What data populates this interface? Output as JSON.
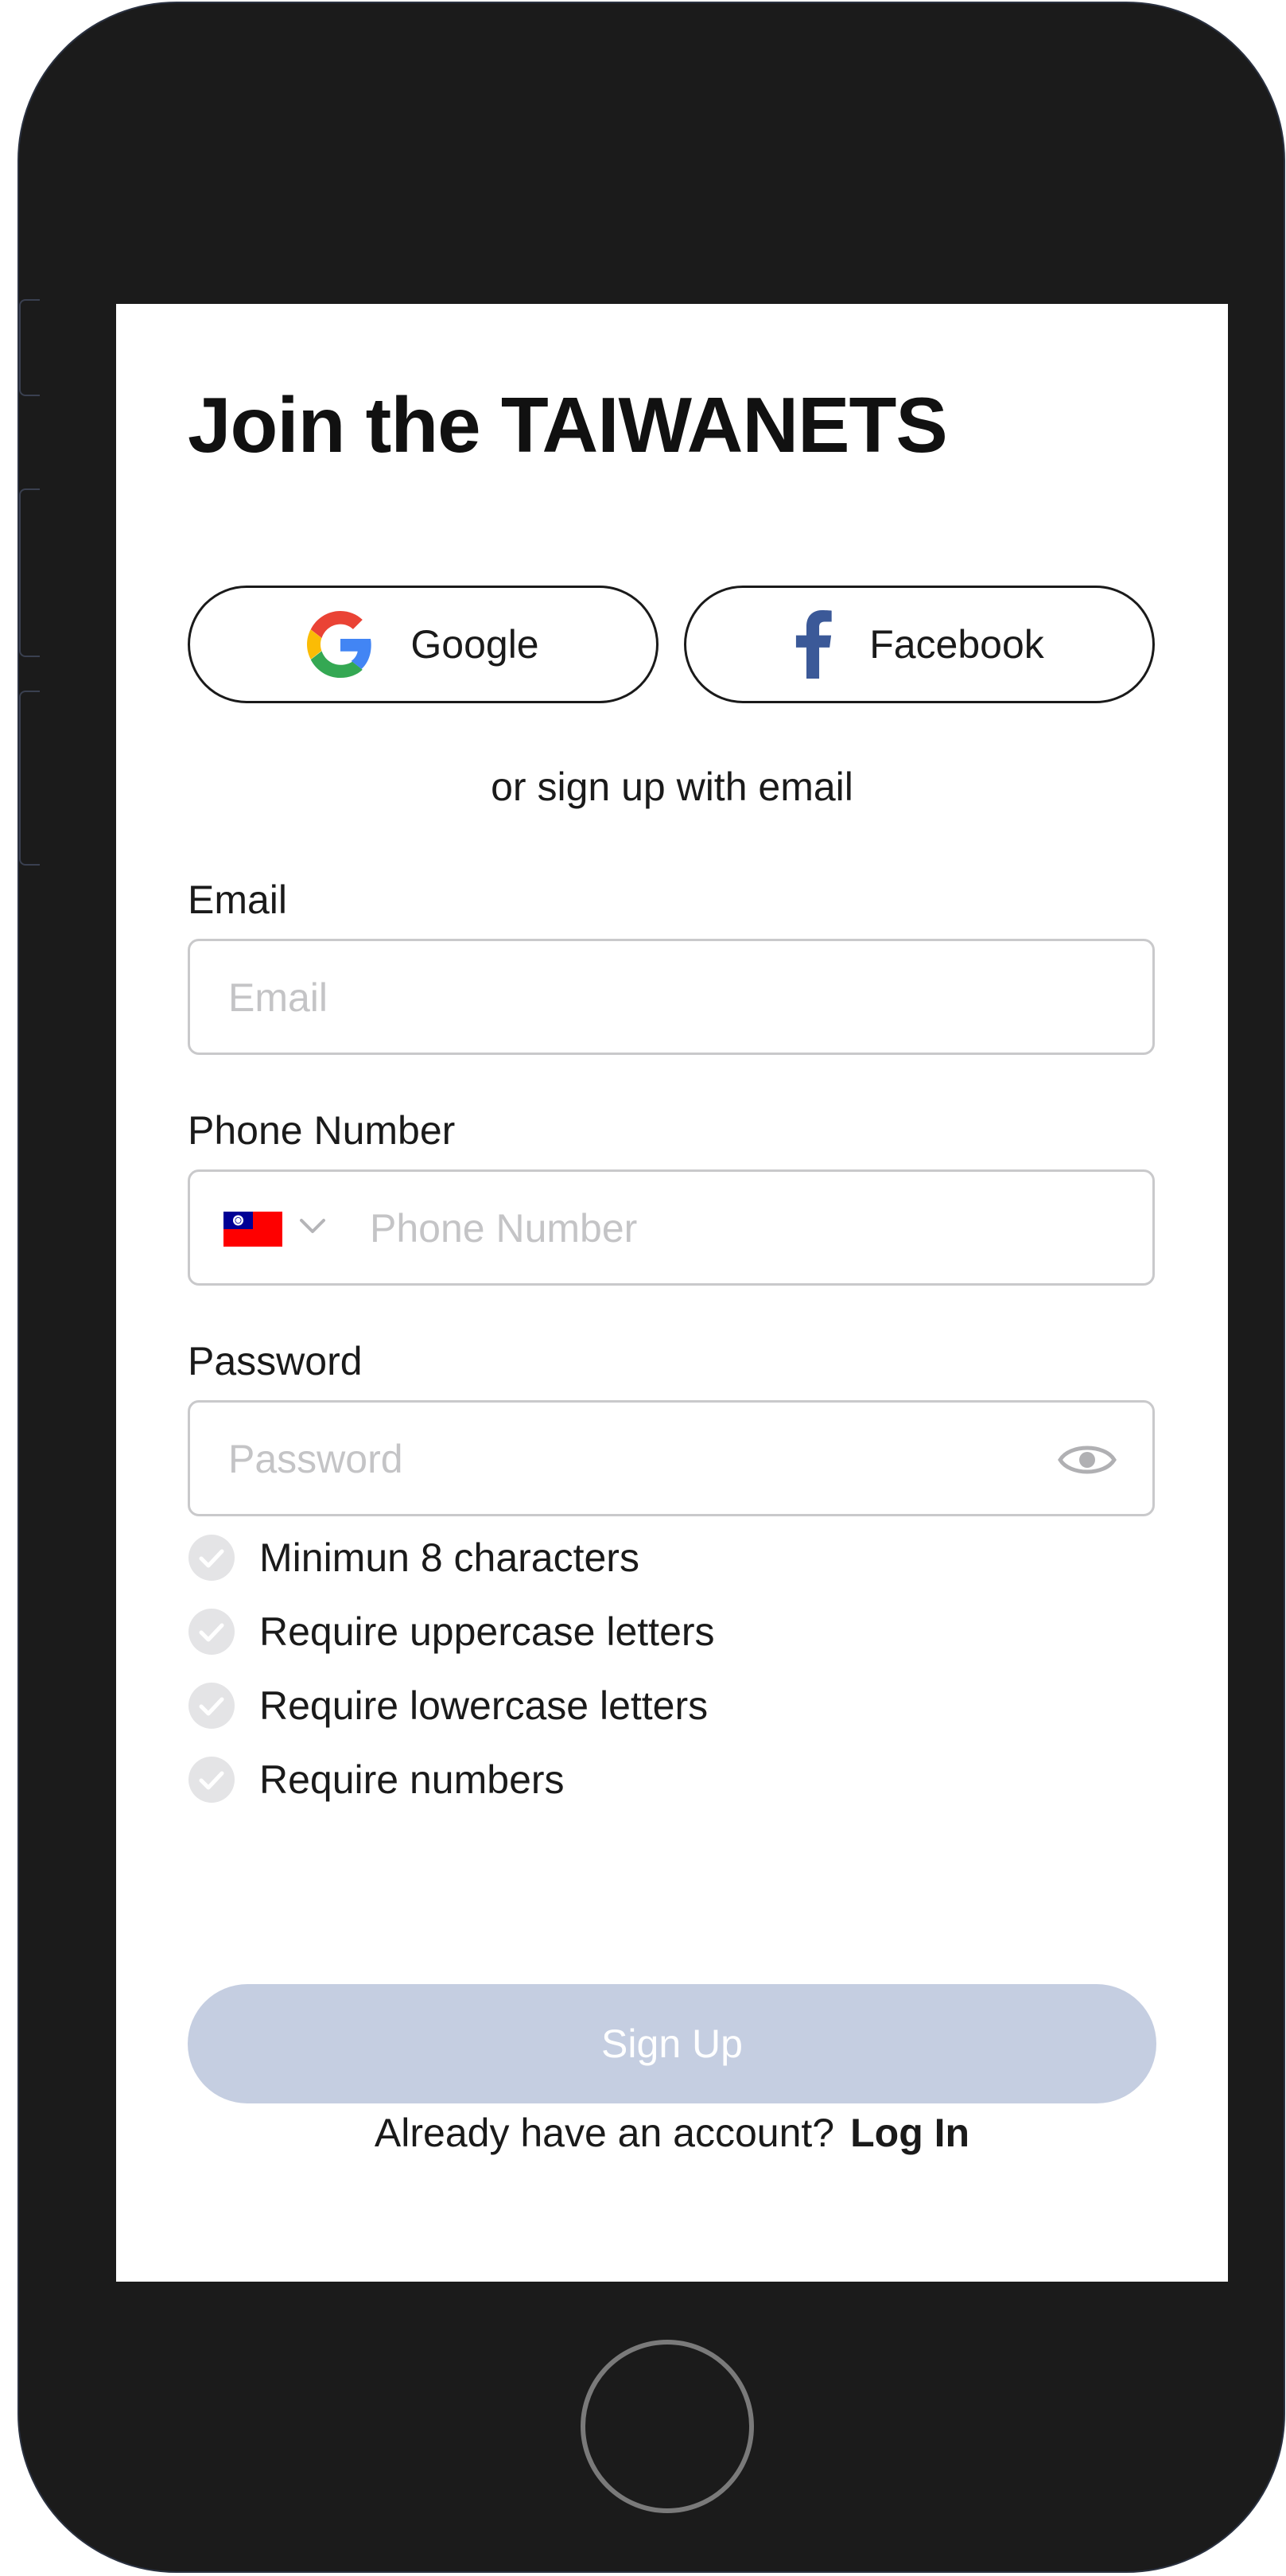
{
  "title": "Join the TAIWANETS",
  "social": {
    "google_label": "Google",
    "facebook_label": "Facebook"
  },
  "divider_text": "or sign up with email",
  "fields": {
    "email": {
      "label": "Email",
      "placeholder": "Email",
      "value": ""
    },
    "phone": {
      "label": "Phone Number",
      "placeholder": "Phone Number",
      "value": "",
      "country_flag": "taiwan-flag-icon"
    },
    "password": {
      "label": "Password",
      "placeholder": "Password",
      "value": ""
    }
  },
  "requirements": [
    {
      "text": "Minimun 8 characters",
      "met": false
    },
    {
      "text": "Require uppercase letters",
      "met": false
    },
    {
      "text": "Require lowercase letters",
      "met": false
    },
    {
      "text": "Require numbers",
      "met": false
    }
  ],
  "signup_button": {
    "label": "Sign Up",
    "disabled": true
  },
  "login_prompt": {
    "text": "Already have an account?",
    "link": "Log In"
  },
  "colors": {
    "signup_disabled": "#c5cee1",
    "facebook_blue": "#3b5998",
    "check_gray": "#e4e4e6",
    "input_border": "#c9c9cb",
    "phone_frame": "#1b1b1b"
  }
}
